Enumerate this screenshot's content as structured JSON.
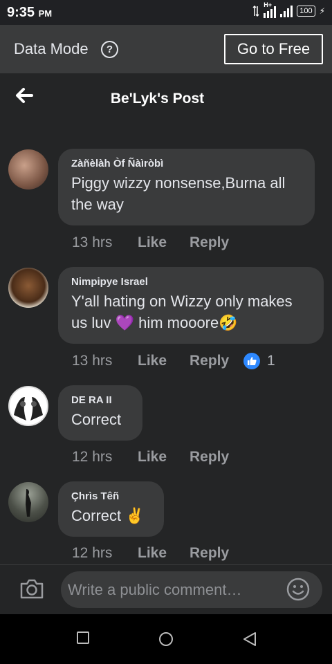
{
  "status_bar": {
    "time": "9:35",
    "ampm": "PM",
    "network": "H+",
    "battery": "100"
  },
  "banner": {
    "label": "Data Mode",
    "help_icon": "question-circle-icon",
    "button": "Go to Free"
  },
  "header": {
    "back_icon": "arrow-left-icon",
    "title": "Be'Lyk's Post"
  },
  "comments": [
    {
      "name": "Zàñèlàh Òf Ñàìròbì",
      "text": "Piggy wizzy nonsense,Burna all the way",
      "time": "13 hrs",
      "like": "Like",
      "reply": "Reply"
    },
    {
      "name": "Nimpipye Israel",
      "text": "Y'all hating on Wizzy only makes us luv 💜 him mooore🤣",
      "time": "13 hrs",
      "like": "Like",
      "reply": "Reply",
      "reaction_count": "1",
      "reaction_icon": "thumbs-up-icon"
    },
    {
      "name": "DE RA II",
      "text": "Correct",
      "time": "12 hrs",
      "like": "Like",
      "reply": "Reply"
    },
    {
      "name": "Çhrìs Têñ",
      "text": "Correct ✌️",
      "time": "12 hrs",
      "like": "Like",
      "reply": "Reply"
    }
  ],
  "composer": {
    "camera_icon": "camera-icon",
    "placeholder": "Write a public comment…",
    "emoji_icon": "smiley-icon"
  },
  "nav": {
    "recents": "square-icon",
    "home": "circle-icon",
    "back": "triangle-back-icon"
  },
  "colors": {
    "background": "#18191a",
    "surface": "#242526",
    "bubble": "#3a3b3c",
    "reaction_blue": "#2d88ff"
  }
}
